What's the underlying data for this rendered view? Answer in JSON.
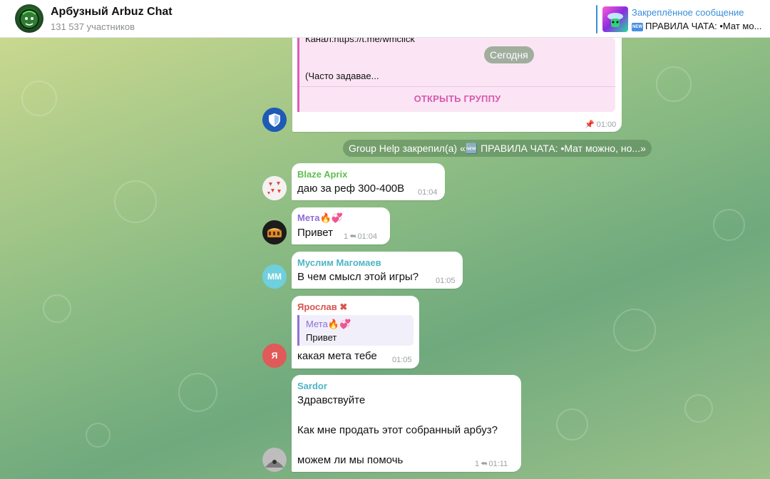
{
  "header": {
    "title": "Арбузный Arbuz Chat",
    "subtitle": "131 537 участников",
    "pinned_title": "Закреплённое сообщение",
    "pinned_badge": "NEW",
    "pinned_text": "ПРАВИЛА ЧАТА: •Мат мо..."
  },
  "card": {
    "line1": "Канал:https://t.me/wmclick",
    "line2": "(Часто задавае...",
    "open_label": "ОТКРЫТЬ ГРУППУ",
    "time": "01:00"
  },
  "date_badge": "Сегодня",
  "pin_service": "Group Help закрепил(а) «🆕 ПРАВИЛА ЧАТА: •Мат можно, но...»",
  "messages": [
    {
      "sender": "Blaze Aprix",
      "text": "даю за реф 300-400В",
      "time": "01:04",
      "sender_color": "#5fbf4f"
    },
    {
      "sender": "Мета🔥💞",
      "text": "Привет",
      "replies": "1",
      "time": "01:04",
      "sender_color": "#8e6dd6"
    },
    {
      "sender": "Муслим Магомаев",
      "text": "В чем смысл этой игры?",
      "time": "01:05",
      "sender_color": "#4cb5c4",
      "avatar_text": "ММ"
    },
    {
      "sender": "Ярослав ✖",
      "reply_to": "Мета🔥💞",
      "reply_text": "Привет",
      "text": "какая мета тебе",
      "time": "01:05",
      "sender_color": "#d9534f",
      "avatar_text": "Я"
    },
    {
      "sender": "Sardor",
      "lines": [
        "Здравствуйте",
        "Как мне продать этот собранный арбуз?",
        "можем ли мы помочь"
      ],
      "replies": "1",
      "time": "01:11",
      "sender_color": "#4cb5c4"
    }
  ],
  "colors": {
    "accent": "#3a8ed9",
    "card_accent": "#e05bb8",
    "reply_accent": "#9072d6"
  },
  "icons": {
    "pin": "pin-icon",
    "reply": "reply-arrow-icon",
    "shield": "shield-icon"
  }
}
